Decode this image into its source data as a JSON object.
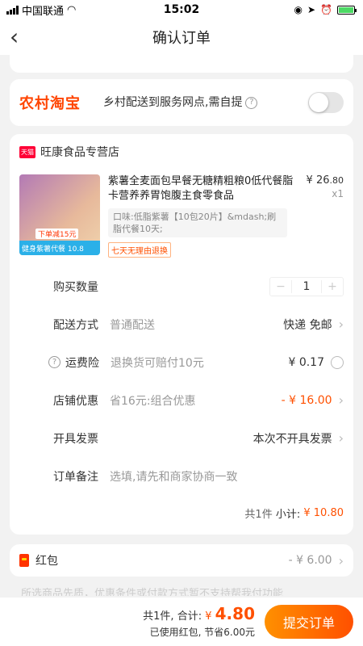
{
  "status": {
    "carrier": "中国联通",
    "time": "15:02"
  },
  "nav": {
    "title": "确认订单"
  },
  "rural": {
    "logo": "农村淘宝",
    "text": "乡村配送到服务网点,需自提"
  },
  "shop": {
    "badge": "天猫",
    "name": "旺康食品专营店"
  },
  "product": {
    "title": "紫薯全麦面包早餐无糖精粗粮0低代餐脂卡营养养胃饱腹主食零食品",
    "sku": "口味:低脂紫薯【10包20片】&mdash;刷脂代餐10天;",
    "service_tag": "七天无理由退换",
    "price_symbol": "¥",
    "price_int": "26",
    "price_dec": ".80",
    "qty": "x1",
    "thumb_bar": "健身紫薯代餐 10.8",
    "thumb_tag": "下单减15元"
  },
  "rows": {
    "quantity": {
      "label": "购买数量",
      "value": "1",
      "minus": "−",
      "plus": "+"
    },
    "delivery": {
      "label": "配送方式",
      "sub": "普通配送",
      "value": "快递 免邮"
    },
    "insurance": {
      "label": "运费险",
      "sub": "退换货可赔付10元",
      "value": "¥ 0.17"
    },
    "discount": {
      "label": "店铺优惠",
      "sub": "省16元:组合优惠",
      "value": "- ¥ 16.00"
    },
    "invoice": {
      "label": "开具发票",
      "value": "本次不开具发票"
    },
    "note": {
      "label": "订单备注",
      "placeholder": "选填,请先和商家协商一致"
    }
  },
  "subtotal": {
    "count": "共1件",
    "label": "小计:",
    "value": "¥ 10.80"
  },
  "hongbao": {
    "label": "红包",
    "value": "- ¥ 6.00"
  },
  "faded_text": "所选商品先质，优惠条件或付款方式暂不支持帮我付功能",
  "bottom": {
    "count": "共1件,",
    "total_label": "合计:",
    "total_symbol": "¥",
    "total_value": "4.80",
    "saved": "已使用红包, 节省6.00元",
    "submit": "提交订单"
  }
}
